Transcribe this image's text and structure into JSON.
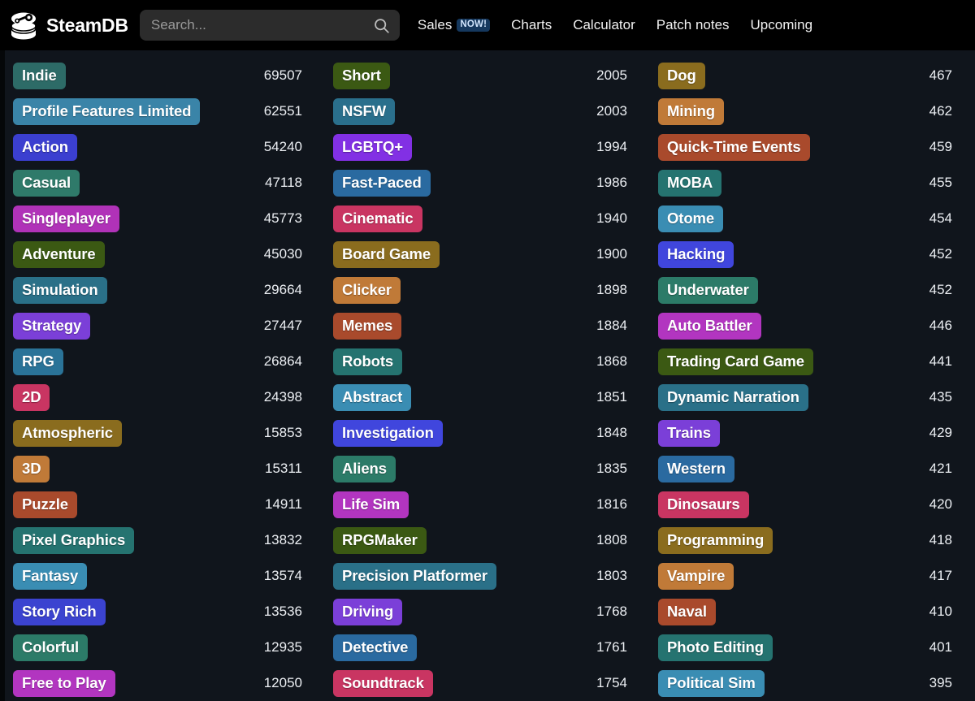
{
  "header": {
    "brand_name": "SteamDB",
    "logo_icon": "steamdb-database-logo",
    "search": {
      "placeholder": "Search...",
      "value": "",
      "icon": "search-icon"
    },
    "nav": [
      {
        "label": "Sales",
        "badge": "NOW!"
      },
      {
        "label": "Charts",
        "badge": ""
      },
      {
        "label": "Calculator",
        "badge": ""
      },
      {
        "label": "Patch notes",
        "badge": ""
      },
      {
        "label": "Upcoming",
        "badge": ""
      }
    ]
  },
  "colors": {
    "page_background": "#10151c",
    "header_background": "#000000",
    "badge_background": "#15385e",
    "badge_text": "#cfe3fb",
    "count_text": "#eceff3",
    "search_background": "#2c2c2c"
  },
  "columns": [
    {
      "tags": [
        {
          "label": "Indie",
          "count": "69507",
          "color": "#2d6b67"
        },
        {
          "label": "Profile Features Limited",
          "count": "62551",
          "color": "#3a84a8"
        },
        {
          "label": "Action",
          "count": "54240",
          "color": "#3b3fd0"
        },
        {
          "label": "Casual",
          "count": "47118",
          "color": "#2f7a6a"
        },
        {
          "label": "Singleplayer",
          "count": "45773",
          "color": "#b032b8"
        },
        {
          "label": "Adventure",
          "count": "45030",
          "color": "#3b5913"
        },
        {
          "label": "Simulation",
          "count": "29664",
          "color": "#2a7088"
        },
        {
          "label": "Strategy",
          "count": "27447",
          "color": "#7b3fd8"
        },
        {
          "label": "RPG",
          "count": "26864",
          "color": "#2a7398"
        },
        {
          "label": "2D",
          "count": "24398",
          "color": "#c93562"
        },
        {
          "label": "Atmospheric",
          "count": "15853",
          "color": "#8a6c1e"
        },
        {
          "label": "3D",
          "count": "15311",
          "color": "#c07a38"
        },
        {
          "label": "Puzzle",
          "count": "14911",
          "color": "#a94a2c"
        },
        {
          "label": "Pixel Graphics",
          "count": "13832",
          "color": "#257370"
        },
        {
          "label": "Fantasy",
          "count": "13574",
          "color": "#3a8db3"
        },
        {
          "label": "Story Rich",
          "count": "13536",
          "color": "#3b43d0"
        },
        {
          "label": "Colorful",
          "count": "12935",
          "color": "#2c7b68"
        },
        {
          "label": "Free to Play",
          "count": "12050",
          "color": "#b235c0"
        }
      ]
    },
    {
      "tags": [
        {
          "label": "Short",
          "count": "2005",
          "color": "#3b5913"
        },
        {
          "label": "NSFW",
          "count": "2003",
          "color": "#2a6f8c"
        },
        {
          "label": "LGBTQ+",
          "count": "1994",
          "color": "#8230e4"
        },
        {
          "label": "Fast-Paced",
          "count": "1986",
          "color": "#2a6aa0"
        },
        {
          "label": "Cinematic",
          "count": "1940",
          "color": "#c93562"
        },
        {
          "label": "Board Game",
          "count": "1900",
          "color": "#8a6c1e"
        },
        {
          "label": "Clicker",
          "count": "1898",
          "color": "#c07a38"
        },
        {
          "label": "Memes",
          "count": "1884",
          "color": "#a94a2c"
        },
        {
          "label": "Robots",
          "count": "1868",
          "color": "#257370"
        },
        {
          "label": "Abstract",
          "count": "1851",
          "color": "#3a8db3"
        },
        {
          "label": "Investigation",
          "count": "1848",
          "color": "#4046dd"
        },
        {
          "label": "Aliens",
          "count": "1835",
          "color": "#2c7b68"
        },
        {
          "label": "Life Sim",
          "count": "1816",
          "color": "#b235c0"
        },
        {
          "label": "RPGMaker",
          "count": "1808",
          "color": "#3b5913"
        },
        {
          "label": "Precision Platformer",
          "count": "1803",
          "color": "#2a7088"
        },
        {
          "label": "Driving",
          "count": "1768",
          "color": "#7b3fd8"
        },
        {
          "label": "Detective",
          "count": "1761",
          "color": "#2a6aa0"
        },
        {
          "label": "Soundtrack",
          "count": "1754",
          "color": "#c93562"
        }
      ]
    },
    {
      "tags": [
        {
          "label": "Dog",
          "count": "467",
          "color": "#8a6c1e"
        },
        {
          "label": "Mining",
          "count": "462",
          "color": "#c07a38"
        },
        {
          "label": "Quick-Time Events",
          "count": "459",
          "color": "#a94a2c"
        },
        {
          "label": "MOBA",
          "count": "455",
          "color": "#257370"
        },
        {
          "label": "Otome",
          "count": "454",
          "color": "#3a8db3"
        },
        {
          "label": "Hacking",
          "count": "452",
          "color": "#4046dd"
        },
        {
          "label": "Underwater",
          "count": "452",
          "color": "#2c7b68"
        },
        {
          "label": "Auto Battler",
          "count": "446",
          "color": "#b235c0"
        },
        {
          "label": "Trading Card Game",
          "count": "441",
          "color": "#3b5913"
        },
        {
          "label": "Dynamic Narration",
          "count": "435",
          "color": "#2a7088"
        },
        {
          "label": "Trains",
          "count": "429",
          "color": "#7b3fd8"
        },
        {
          "label": "Western",
          "count": "421",
          "color": "#2a6aa0"
        },
        {
          "label": "Dinosaurs",
          "count": "420",
          "color": "#c93562"
        },
        {
          "label": "Programming",
          "count": "418",
          "color": "#8a6c1e"
        },
        {
          "label": "Vampire",
          "count": "417",
          "color": "#c07a38"
        },
        {
          "label": "Naval",
          "count": "410",
          "color": "#a94a2c"
        },
        {
          "label": "Photo Editing",
          "count": "401",
          "color": "#257370"
        },
        {
          "label": "Political Sim",
          "count": "395",
          "color": "#3a8db3"
        }
      ]
    }
  ]
}
